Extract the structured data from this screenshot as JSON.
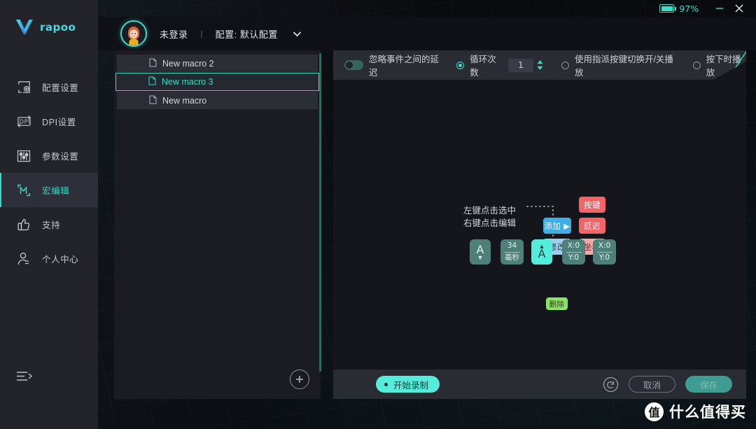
{
  "window": {
    "battery_percent": "97%",
    "minimize_label": "—",
    "close_label": "✕",
    "accent_color": "#3ddbc8"
  },
  "brand": {
    "name": "rapoo",
    "logo_icon": "rapoo-v-logo"
  },
  "sidebar": {
    "items": [
      {
        "label": "配置设置",
        "icon": "profile-settings-icon",
        "active": false
      },
      {
        "label": "DPI设置",
        "icon": "dpi-icon",
        "active": false
      },
      {
        "label": "参数设置",
        "icon": "sliders-icon",
        "active": false
      },
      {
        "label": "宏编辑",
        "icon": "macro-m-icon",
        "active": true
      },
      {
        "label": "支持",
        "icon": "thumbs-up-icon",
        "active": false
      },
      {
        "label": "个人中心",
        "icon": "user-icon",
        "active": false
      }
    ],
    "collapse_icon": "collapse-menu-icon"
  },
  "account": {
    "login_status": "未登录",
    "separator": "|",
    "profile_label": "配置: 默认配置",
    "caret_icon": "chevron-down-icon",
    "avatar_icon": "user-avatar"
  },
  "macro_list": {
    "items": [
      {
        "name": "New macro 2",
        "selected": false
      },
      {
        "name": "New macro 3",
        "selected": true
      },
      {
        "name": "New macro",
        "selected": false
      }
    ],
    "add_button_icon": "plus-circle-icon"
  },
  "toolbar": {
    "ignore_delay_label": "忽略事件之间的延迟",
    "ignore_delay_on": false,
    "loop_count_label": "循环次数",
    "loop_count_selected": true,
    "loop_count_value": "1",
    "toggle_play_label": "使用指派按键切换开/关播放",
    "toggle_play_selected": false,
    "play_on_press_label": "按下时播放",
    "play_on_press_selected": false,
    "spinner_up_icon": "caret-up-icon",
    "spinner_down_icon": "caret-down-icon"
  },
  "canvas": {
    "hint_line1": "左键点击选中",
    "hint_line2": "右键点击编辑",
    "context_menu": {
      "add_label": "添加 ▶",
      "modify_label": "修改",
      "submenu": [
        {
          "label": "按键",
          "color": "#f0656a"
        },
        {
          "label": "延迟",
          "color": "#f0656a"
        },
        {
          "label": "坐标",
          "color": "#f6a7a9"
        }
      ]
    },
    "delete_label": "删除",
    "events": [
      {
        "type": "key-up",
        "key": "A",
        "arrow": "▼",
        "position": "below",
        "active": false
      },
      {
        "type": "delay",
        "line1": "34",
        "line2": "毫秒",
        "active": false
      },
      {
        "type": "key-down",
        "key": "A",
        "arrow": "▲",
        "position": "above",
        "active": true
      },
      {
        "type": "coord",
        "line1": "X:0",
        "line2": "Y:0",
        "active": false
      },
      {
        "type": "coord",
        "line1": "X:0",
        "line2": "Y:0",
        "active": false
      }
    ]
  },
  "actions": {
    "record_label": "开始录制",
    "reset_icon": "reset-circular-arrow-icon",
    "cancel_label": "取消",
    "save_label": "保存"
  },
  "watermark": {
    "badge": "值",
    "text": "什么值得买"
  }
}
